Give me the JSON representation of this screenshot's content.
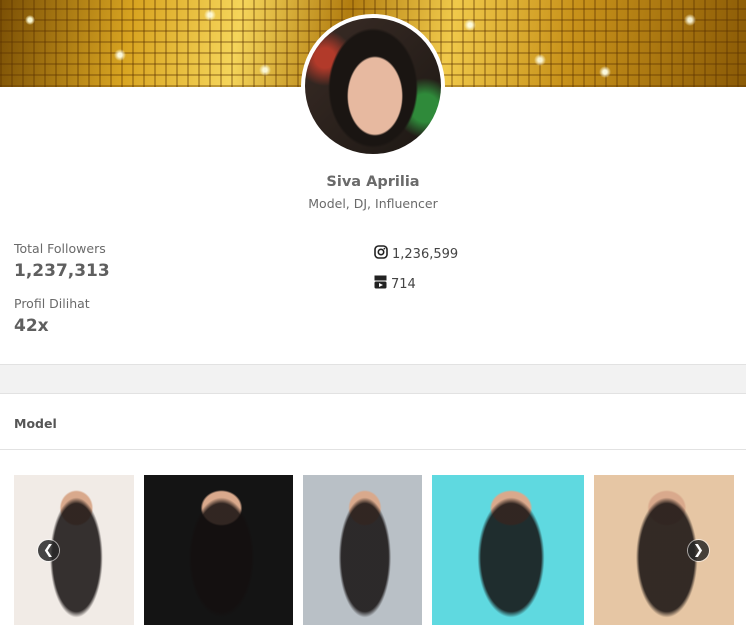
{
  "profile": {
    "name": "Siva Aprilia",
    "subtitle": "Model, DJ, Influencer"
  },
  "stats": {
    "total_followers_label": "Total Followers",
    "total_followers_value": "1,237,313",
    "views_label": "Profil Dilihat",
    "views_value": "42x"
  },
  "social": {
    "instagram_count": "1,236,599",
    "youtube_count": "714",
    "instagram_icon": "instagram-icon",
    "youtube_icon": "youtube-icon"
  },
  "gallery": {
    "section_title": "Model",
    "prev_icon": "arrow-left-icon",
    "next_icon": "arrow-right-icon",
    "photos": [
      {
        "bg": "#f1ebe6"
      },
      {
        "bg": "#141414"
      },
      {
        "bg": "#b9c0c6"
      },
      {
        "bg": "#5fd9e0"
      },
      {
        "bg": "#e6c6a4"
      }
    ]
  },
  "colors": {
    "banner_gold": "#d9a521",
    "text": "#6a6a6a"
  }
}
